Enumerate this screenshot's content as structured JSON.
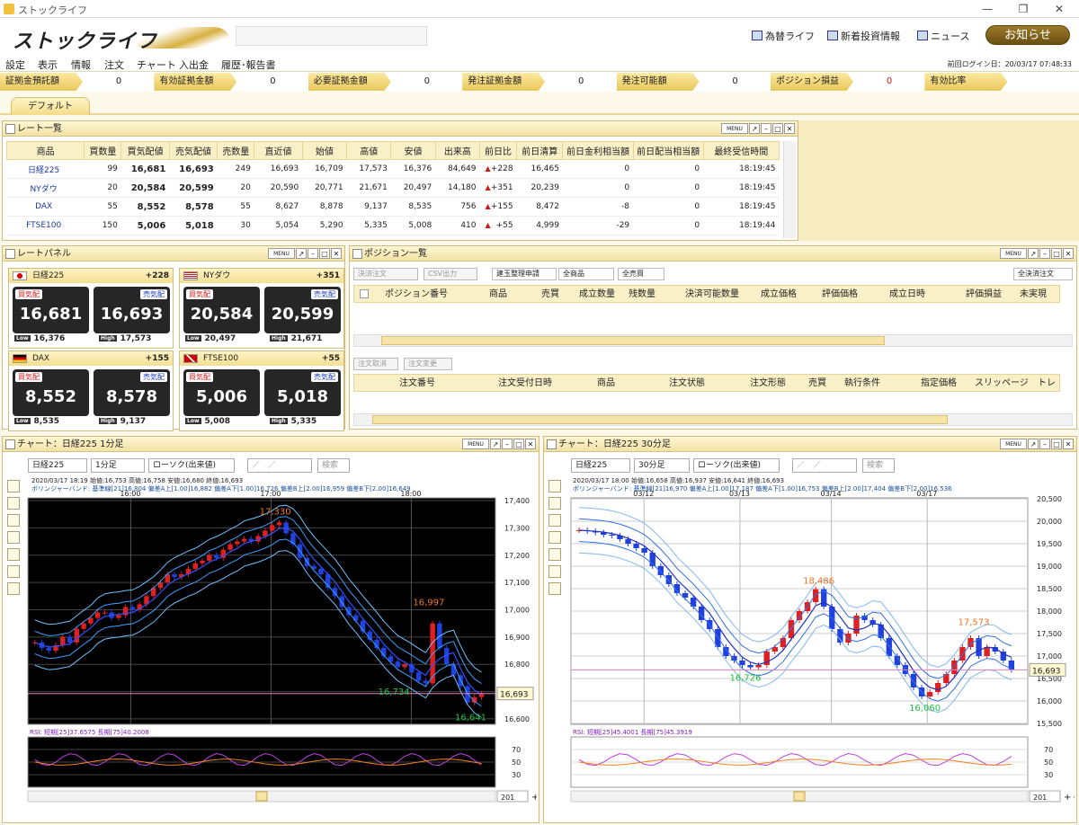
{
  "window": {
    "title": "ストックライフ",
    "min": "—",
    "restore": "❐",
    "close": "✕"
  },
  "header": {
    "logo_text": "ストックライフ",
    "links": [
      "為替ライフ",
      "新着投資情報",
      "ニュース"
    ],
    "notice_button": "お知らせ"
  },
  "menu": {
    "items": [
      "設定",
      "表示",
      "情報",
      "注文",
      "チャート",
      "入出金",
      "履歴･報告書"
    ],
    "last_login": "前回ログイン日：20/03/17 07:48:33"
  },
  "account": {
    "items": [
      {
        "label": "証拠金預託額",
        "value": "0"
      },
      {
        "label": "有効証拠金額",
        "value": "0"
      },
      {
        "label": "必要証拠金額",
        "value": "0"
      },
      {
        "label": "発注証拠金額",
        "value": "0"
      },
      {
        "label": "発注可能額",
        "value": "0"
      },
      {
        "label": "ポジション損益",
        "value": "0"
      },
      {
        "label": "有効比率",
        "value": ""
      }
    ]
  },
  "tabs": {
    "default": "デフォルト"
  },
  "rate_list": {
    "title": "レート一覧",
    "menu": "MENU",
    "columns": [
      "商品",
      "買数量",
      "買気配値",
      "売気配値",
      "売数量",
      "直近値",
      "始値",
      "高値",
      "安値",
      "出来高",
      "前日比",
      "前日清算",
      "前日金利相当額",
      "前日配当相当額",
      "最終受信時間"
    ],
    "rows": [
      {
        "name": "日経225",
        "buy_qty": "99",
        "bid": "16,681",
        "ask": "16,693",
        "sell_qty": "249",
        "last": "16,693",
        "open": "16,709",
        "high": "17,573",
        "low": "16,376",
        "volume": "84,649",
        "change": "+228",
        "prev_settle": "16,465",
        "interest": "0",
        "dividend": "0",
        "time": "18:19:45"
      },
      {
        "name": "NYダウ",
        "buy_qty": "20",
        "bid": "20,584",
        "ask": "20,599",
        "sell_qty": "20",
        "last": "20,590",
        "open": "20,771",
        "high": "21,671",
        "low": "20,497",
        "volume": "14,180",
        "change": "+351",
        "prev_settle": "20,239",
        "interest": "0",
        "dividend": "0",
        "time": "18:19:45"
      },
      {
        "name": "DAX",
        "buy_qty": "55",
        "bid": "8,552",
        "ask": "8,578",
        "sell_qty": "55",
        "last": "8,627",
        "open": "8,878",
        "high": "9,137",
        "low": "8,535",
        "volume": "756",
        "change": "+155",
        "prev_settle": "8,472",
        "interest": "-8",
        "dividend": "0",
        "time": "18:19:45"
      },
      {
        "name": "FTSE100",
        "buy_qty": "150",
        "bid": "5,006",
        "ask": "5,018",
        "sell_qty": "30",
        "last": "5,054",
        "open": "5,290",
        "high": "5,335",
        "low": "5,008",
        "volume": "410",
        "change": "+55",
        "prev_settle": "4,999",
        "interest": "-29",
        "dividend": "0",
        "time": "18:19:44"
      }
    ]
  },
  "rate_panel": {
    "title": "レートパネル",
    "menu": "MENU",
    "bid_label": "買気配",
    "ask_label": "売気配",
    "low_label": "Low",
    "high_label": "High",
    "tiles": [
      {
        "name": "日経225",
        "change": "+228",
        "bid": "16,681",
        "ask": "16,693",
        "low": "16,376",
        "high": "17,573",
        "flag": "jp"
      },
      {
        "name": "NYダウ",
        "change": "+351",
        "bid": "20,584",
        "ask": "20,599",
        "low": "20,497",
        "high": "21,671",
        "flag": "us"
      },
      {
        "name": "DAX",
        "change": "+155",
        "bid": "8,552",
        "ask": "8,578",
        "low": "8,535",
        "high": "9,137",
        "flag": "de"
      },
      {
        "name": "FTSE100",
        "change": "+55",
        "bid": "5,006",
        "ask": "5,018",
        "low": "5,008",
        "high": "5,335",
        "flag": "uk"
      }
    ]
  },
  "positions": {
    "title": "ポジション一覧",
    "menu": "MENU",
    "btn_settle": "決済注文",
    "btn_csv": "CSV出力",
    "btn_build": "建玉整理申請",
    "select_product": "全商品",
    "select_side": "全売買",
    "btn_all_settle": "全決済注文",
    "columns": [
      "ポジション番号",
      "商品",
      "売買",
      "成立数量",
      "残数量",
      "決済可能数量",
      "成立価格",
      "評価価格",
      "成立日時",
      "評価損益",
      "未実現"
    ],
    "btn_cancel": "注文取消",
    "btn_modify": "注文変更",
    "order_columns": [
      "注文番号",
      "注文受付日時",
      "商品",
      "注文状態",
      "注文形態",
      "売買",
      "執行条件",
      "指定価格",
      "スリッページ",
      "トレ"
    ]
  },
  "chart1": {
    "title": "チャート：日経225 1分足",
    "menu": "MENU",
    "product": "日経225",
    "interval": "1分足",
    "type": "ローソク(出来値)",
    "date": "／　／",
    "btn_search": "検索",
    "info": "2020/03/17 18:19  始値:16,753  高値:16,758  安値:16,680  終値:16,693",
    "bb": "ボリンジャーバンド: 基準線[21]16,804  偏差A上[1.00]16,882  偏差A下[1.00]16,726  偏差B上[2.00]16,959  偏差B下[2.00]16,649",
    "rsi": "RSI: 短期[25]37.6575  長期[75]40.2008",
    "zoom": "201"
  },
  "chart2": {
    "title": "チャート：日経225 30分足",
    "menu": "MENU",
    "product": "日経225",
    "interval": "30分足",
    "type": "ローソク(出来値)",
    "date": "／　／",
    "btn_search": "検索",
    "info": "2020/03/17 18:00  始値:16,658  高値:16,937  安値:16,641  終値:16,693",
    "bb": "ボリンジャーバンド: 基準線[21]16,970  偏差A上[1.00]17,187  偏差A下[1.00]16,753  偏差B上[2.00]17,404  偏差B下[2.00]16,536",
    "rsi": "RSI: 短期[25]45.4001  長期[75]45.3919",
    "zoom": "201"
  },
  "chart_data": [
    {
      "type": "candlestick",
      "title": "チャート：日経225 1分足",
      "x_ticks": [
        "16:00",
        "17:00",
        "18:00"
      ],
      "y_ticks": [
        "17,400",
        "17,300",
        "17,200",
        "17,100",
        "17,000",
        "16,900",
        "16,800",
        "16,700",
        "16,600"
      ],
      "ylim": [
        16580,
        17410
      ],
      "current_price": "16,693",
      "annotations": [
        {
          "text": "17,330",
          "value": 17330
        },
        {
          "text": "16,997",
          "value": 16997
        },
        {
          "text": "16,734",
          "value": 16734
        },
        {
          "text": "16,641",
          "value": 16641
        }
      ],
      "series": [
        {
          "values": [
            16880,
            16860,
            16850,
            16870,
            16900,
            16880,
            16930,
            16950,
            16970,
            16990,
            16990,
            16970,
            16980,
            17010,
            17000,
            17020,
            17050,
            17080,
            17100,
            17130,
            17120,
            17130,
            17150,
            17170,
            17180,
            17200,
            17190,
            17220,
            17240,
            17250,
            17260,
            17250,
            17270,
            17290,
            17310,
            17320,
            17280,
            17240,
            17190,
            17160,
            17150,
            17130,
            17080,
            17050,
            17010,
            16980,
            16960,
            16920,
            16890,
            16860,
            16830,
            16810,
            16790,
            16800,
            16770,
            16740,
            16730,
            16950,
            16860,
            16800,
            16760,
            16720,
            16660,
            16680,
            16693
          ]
        }
      ],
      "rsi": {
        "y_ticks": [
          "70",
          "50",
          "30"
        ]
      }
    },
    {
      "type": "candlestick",
      "title": "チャート：日経225 30分足",
      "x_ticks": [
        "03/12",
        "03/13",
        "03/14",
        "03/17"
      ],
      "y_ticks": [
        "20,500",
        "20,000",
        "19,500",
        "19,000",
        "18,500",
        "18,000",
        "17,500",
        "17,000",
        "16,500",
        "16,000",
        "15,500"
      ],
      "ylim": [
        15480,
        20520
      ],
      "current_price": "16,693",
      "annotations": [
        {
          "text": "18,486",
          "value": 18486
        },
        {
          "text": "16,726",
          "value": 16726
        },
        {
          "text": "17,573",
          "value": 17573
        },
        {
          "text": "16,060",
          "value": 16060
        }
      ],
      "series": [
        {
          "values": [
            19800,
            19780,
            19750,
            19700,
            19680,
            19600,
            19500,
            19400,
            19300,
            19000,
            18800,
            18600,
            18400,
            18300,
            18100,
            17800,
            17600,
            17200,
            17000,
            16900,
            16800,
            16750,
            16800,
            17100,
            17200,
            17400,
            17800,
            18000,
            18200,
            18486,
            18100,
            17600,
            17300,
            17500,
            17900,
            17800,
            17700,
            17400,
            17000,
            16800,
            16600,
            16300,
            16100,
            16200,
            16400,
            16600,
            16900,
            17200,
            17400,
            17000,
            17200,
            17100,
            16900,
            16693
          ]
        }
      ],
      "rsi": {
        "y_ticks": [
          "70",
          "50",
          "30"
        ]
      }
    }
  ]
}
